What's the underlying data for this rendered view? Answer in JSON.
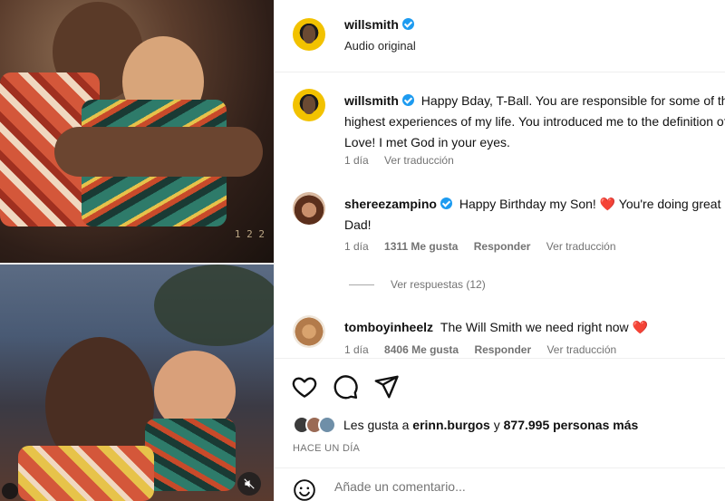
{
  "post": {
    "author": "willsmith",
    "audio": "Audio original"
  },
  "comments": [
    {
      "username": "willsmith",
      "text": "Happy Bday, T-Ball. You are responsible for some of the highest experiences of my life. You introduced me to the definition of Love! I met God in your eyes.",
      "time": "1 día",
      "translate": "Ver traducción"
    },
    {
      "username": "shereezampino",
      "text_before": "Happy Birthday my Son! ",
      "emoji": "❤️",
      "text_after": " You're doing great Dad!",
      "time": "1 día",
      "likes": "1311 Me gusta",
      "reply": "Responder",
      "translate": "Ver traducción",
      "view_replies": "Ver respuestas (12)"
    },
    {
      "username": "tomboyinheelz",
      "text_before": "The Will Smith we need right now ",
      "emoji": "❤️",
      "time": "1 día",
      "likes": "8406 Me gusta",
      "reply": "Responder",
      "translate": "Ver traducción"
    }
  ],
  "likes": {
    "prefix": "Les gusta a ",
    "user": "erinn.burgos",
    "middle": " y ",
    "count": "877.995 personas más"
  },
  "time_ago": "HACE UN DÍA",
  "composer": {
    "placeholder": "Añade un comentario..."
  },
  "photo_stamp": "1 2 2",
  "icons": [
    "heart-icon",
    "comment-icon",
    "share-icon",
    "emoji-icon",
    "mute-icon",
    "verified-icon"
  ],
  "colors": {
    "verified": "#1d9bf0",
    "heart": "#e0173b",
    "meta": "#737373"
  }
}
